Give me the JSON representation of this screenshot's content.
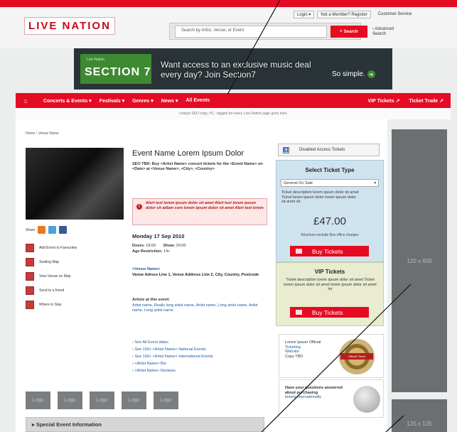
{
  "header": {
    "logo": "LIVE NATION",
    "login_label": "Login ▾",
    "register_label": "Not a Member? Register",
    "customer_service_label": "Customer Service",
    "search_placeholder": "Search by Artist, Venue, or Event",
    "search_button_label": "Search",
    "advanced_search_label": "› Advanced Search"
  },
  "banner": {
    "brand_small": "Live Nation",
    "brand_big": "SECTION 7",
    "headline": "Want access to an exclusive music deal every day? Join Section7",
    "cta": "So simple."
  },
  "nav": {
    "items": [
      "Concerts & Events ▾",
      "Festivals ▾",
      "Genres ▾",
      "News ▾",
      "All Events"
    ],
    "right_items": [
      "VIP Tickets ↗",
      "Ticket Trade ↗"
    ],
    "strip_text": "Unique SEO copy, H1 - tagged for every Live Nation page goes here"
  },
  "breadcrumb": "Home › Venue Name",
  "event": {
    "title": "Event Name Lorem Ipsum Dolor",
    "promo": "SEO TBD: Buy <Artist Name> concert tickets for the <Event Name> on <Date> at <Venue Name>, <City>, <Country>",
    "alert": "Alert text lorem ipsum dolor sit amet Alert text lorem ipsum dolor sit adiam sore lorem ipsum dolor sit amet Alert text lorem",
    "date": "Monday 17 Sep 2010",
    "doors_label": "Doors:",
    "doors_time": "18:00",
    "show_label": "Show:",
    "show_time": "20:00",
    "age_label": "Age Restriction:",
    "age_value": "14+",
    "venue_name": "<Venue Name>",
    "venue_address": "Venue Adress Line 1, Venue Address Line 2, City, Country, Postcode",
    "artists_heading": "Artists at this event:",
    "artists_list": "Artist name, Really long artist name, Artist name, Long artist name, Artist name, Long artist name",
    "more_links": [
      "› See All Event dates",
      "› See 100+ <Artist Name> National Events",
      "› See 100+ <Artist Name> International Events",
      "› <Artist Name> Bio",
      "› <Artist Name> Reviews"
    ]
  },
  "share": {
    "label": "Share"
  },
  "side_links": [
    "Add Event to Favourites",
    "Seating Map",
    "View Venue on Map",
    "Send to a friend",
    "Where to Stay"
  ],
  "logos": [
    "Logo",
    "Logo",
    "Logo",
    "Logo",
    "Logo"
  ],
  "special_section": "▸ Special Event Information",
  "tickets": {
    "access_button": "Disabled Access Tickets",
    "title": "Select Ticket Type",
    "select_value": "General On Sale",
    "description": "Ticket description lorem ipsum dolor sit amet Ticket lorem ipsum dolor lorem ipsum dolor sit amet sit",
    "price": "£47.00",
    "note": "All prices exclude Box office charges",
    "buy_label": "Buy Tickets",
    "vip_title": "VIP Tickets",
    "vip_description": "Ticket description lorem ipsum dolor sit amet Ticket lorem ipsum dolor sit amet lorem ipsum dolor sit amet lor",
    "vip_buy_label": "Buy Tickets"
  },
  "promo1": {
    "text": "Lorem Ipsum Official",
    "links": [
      "Ticketing",
      "Website",
      "Copy TBD"
    ],
    "medal_label": "Official Ticket"
  },
  "promo2": {
    "bold": "Have your questions answered about purchasing",
    "link": "tickets internationally"
  },
  "ads": {
    "tall": "120 x 600",
    "small": "125 x 125"
  },
  "colors": {
    "brand_red": "#e40b22",
    "ticket_blue": "#cfe3ef",
    "vip_green": "#e9ecd0",
    "ad_gray": "#6b6f72"
  }
}
